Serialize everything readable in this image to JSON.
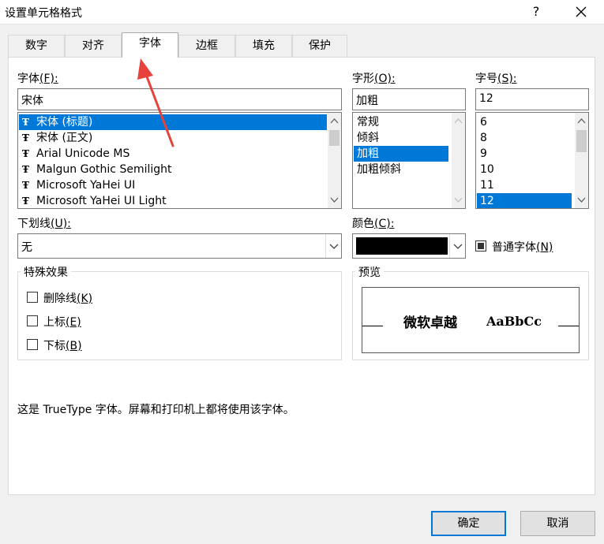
{
  "window": {
    "title": "设置单元格格式",
    "help_glyph": "?"
  },
  "tabs": [
    {
      "label": "数字"
    },
    {
      "label": "对齐"
    },
    {
      "label": "字体",
      "active": true
    },
    {
      "label": "边框"
    },
    {
      "label": "填充"
    },
    {
      "label": "保护"
    }
  ],
  "font": {
    "label": "字体",
    "accel": "(F):",
    "value": "宋体",
    "items": [
      "宋体 (标题)",
      "宋体 (正文)",
      "Arial Unicode MS",
      "Malgun Gothic Semilight",
      "Microsoft YaHei UI",
      "Microsoft YaHei UI Light"
    ],
    "selected_index": 0
  },
  "style": {
    "label": "字形",
    "accel": "(O):",
    "value": "加粗",
    "items": [
      "常规",
      "倾斜",
      "加粗",
      "加粗倾斜"
    ],
    "selected_index": 2
  },
  "size": {
    "label": "字号",
    "accel": "(S):",
    "value": "12",
    "items": [
      "6",
      "8",
      "9",
      "10",
      "11",
      "12"
    ],
    "selected_index": 5
  },
  "underline": {
    "label": "下划线",
    "accel": "(U):",
    "value": "无"
  },
  "color": {
    "label": "颜色",
    "accel": "(C):",
    "value_color": "#000000"
  },
  "normal_font": {
    "label": "普通字体",
    "accel": "(N)",
    "checked": true
  },
  "effects": {
    "title": "特殊效果",
    "items": [
      {
        "label": "删除线",
        "accel": "(K)",
        "checked": false
      },
      {
        "label": "上标",
        "accel": "(E)",
        "checked": false
      },
      {
        "label": "下标",
        "accel": "(B)",
        "checked": false
      }
    ]
  },
  "preview": {
    "title": "预览",
    "text_cn": "微软卓越",
    "text_en": "AaBbCc"
  },
  "info_text": "这是 TrueType 字体。屏幕和打印机上都将使用该字体。",
  "buttons": {
    "ok": "确定",
    "cancel": "取消"
  },
  "colors": {
    "accent": "#0078d7",
    "arrow": "#e8423c"
  },
  "icons": [
    "close-icon",
    "truetype-font-icon",
    "chevron-down-icon",
    "chevron-up-icon",
    "annotation-arrow"
  ]
}
